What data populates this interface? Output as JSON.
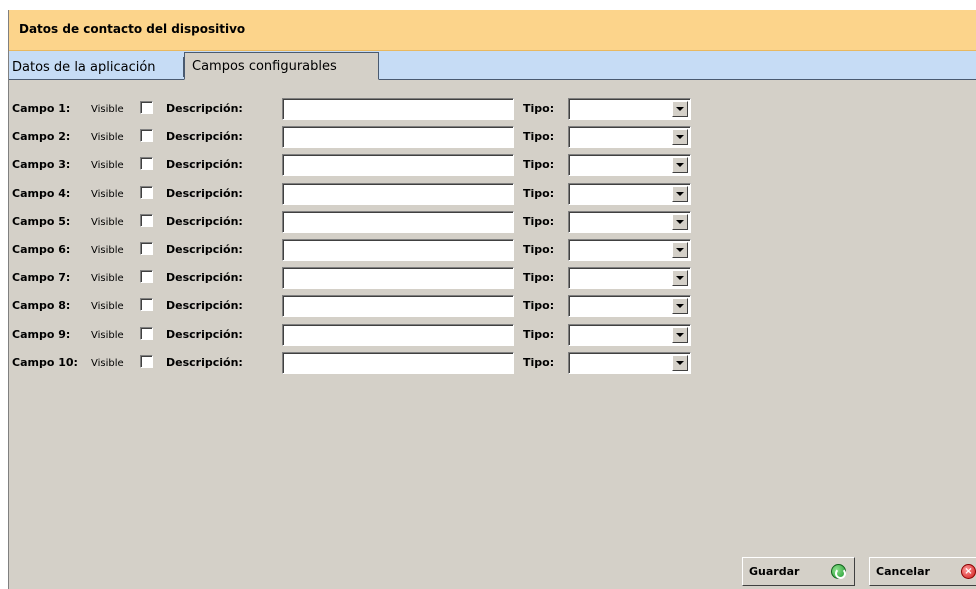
{
  "window": {
    "title": "Datos de contacto del dispositivo"
  },
  "tabs": [
    {
      "label": "Datos de la aplicación",
      "active": false
    },
    {
      "label": "Campos configurables",
      "active": true
    }
  ],
  "fields": [
    {
      "campo": "Campo 1:",
      "visible_label": "Visible",
      "visible_checked": false,
      "desc_label": "Descripción:",
      "desc_value": "",
      "tipo_label": "Tipo:",
      "tipo_value": ""
    },
    {
      "campo": "Campo 2:",
      "visible_label": "Visible",
      "visible_checked": false,
      "desc_label": "Descripción:",
      "desc_value": "",
      "tipo_label": "Tipo:",
      "tipo_value": ""
    },
    {
      "campo": "Campo 3:",
      "visible_label": "Visible",
      "visible_checked": false,
      "desc_label": "Descripción:",
      "desc_value": "",
      "tipo_label": "Tipo:",
      "tipo_value": ""
    },
    {
      "campo": "Campo 4:",
      "visible_label": "Visible",
      "visible_checked": false,
      "desc_label": "Descripción:",
      "desc_value": "",
      "tipo_label": "Tipo:",
      "tipo_value": ""
    },
    {
      "campo": "Campo 5:",
      "visible_label": "Visible",
      "visible_checked": false,
      "desc_label": "Descripción:",
      "desc_value": "",
      "tipo_label": "Tipo:",
      "tipo_value": ""
    },
    {
      "campo": "Campo 6:",
      "visible_label": "Visible",
      "visible_checked": false,
      "desc_label": "Descripción:",
      "desc_value": "",
      "tipo_label": "Tipo:",
      "tipo_value": ""
    },
    {
      "campo": "Campo 7:",
      "visible_label": "Visible",
      "visible_checked": false,
      "desc_label": "Descripción:",
      "desc_value": "",
      "tipo_label": "Tipo:",
      "tipo_value": ""
    },
    {
      "campo": "Campo 8:",
      "visible_label": "Visible",
      "visible_checked": false,
      "desc_label": "Descripción:",
      "desc_value": "",
      "tipo_label": "Tipo:",
      "tipo_value": ""
    },
    {
      "campo": "Campo 9:",
      "visible_label": "Visible",
      "visible_checked": false,
      "desc_label": "Descripción:",
      "desc_value": "",
      "tipo_label": "Tipo:",
      "tipo_value": ""
    },
    {
      "campo": "Campo 10:",
      "visible_label": "Visible",
      "visible_checked": false,
      "desc_label": "Descripción:",
      "desc_value": "",
      "tipo_label": "Tipo:",
      "tipo_value": ""
    }
  ],
  "buttons": {
    "save_label": "Guardar",
    "save_icon": "green-check-circle-icon",
    "cancel_label": "Cancelar",
    "cancel_icon": "red-x-circle-icon"
  },
  "colors": {
    "title_bar": "#fcd48b",
    "tab_strip": "#c6dcf5",
    "panel": "#d4d0c8"
  }
}
